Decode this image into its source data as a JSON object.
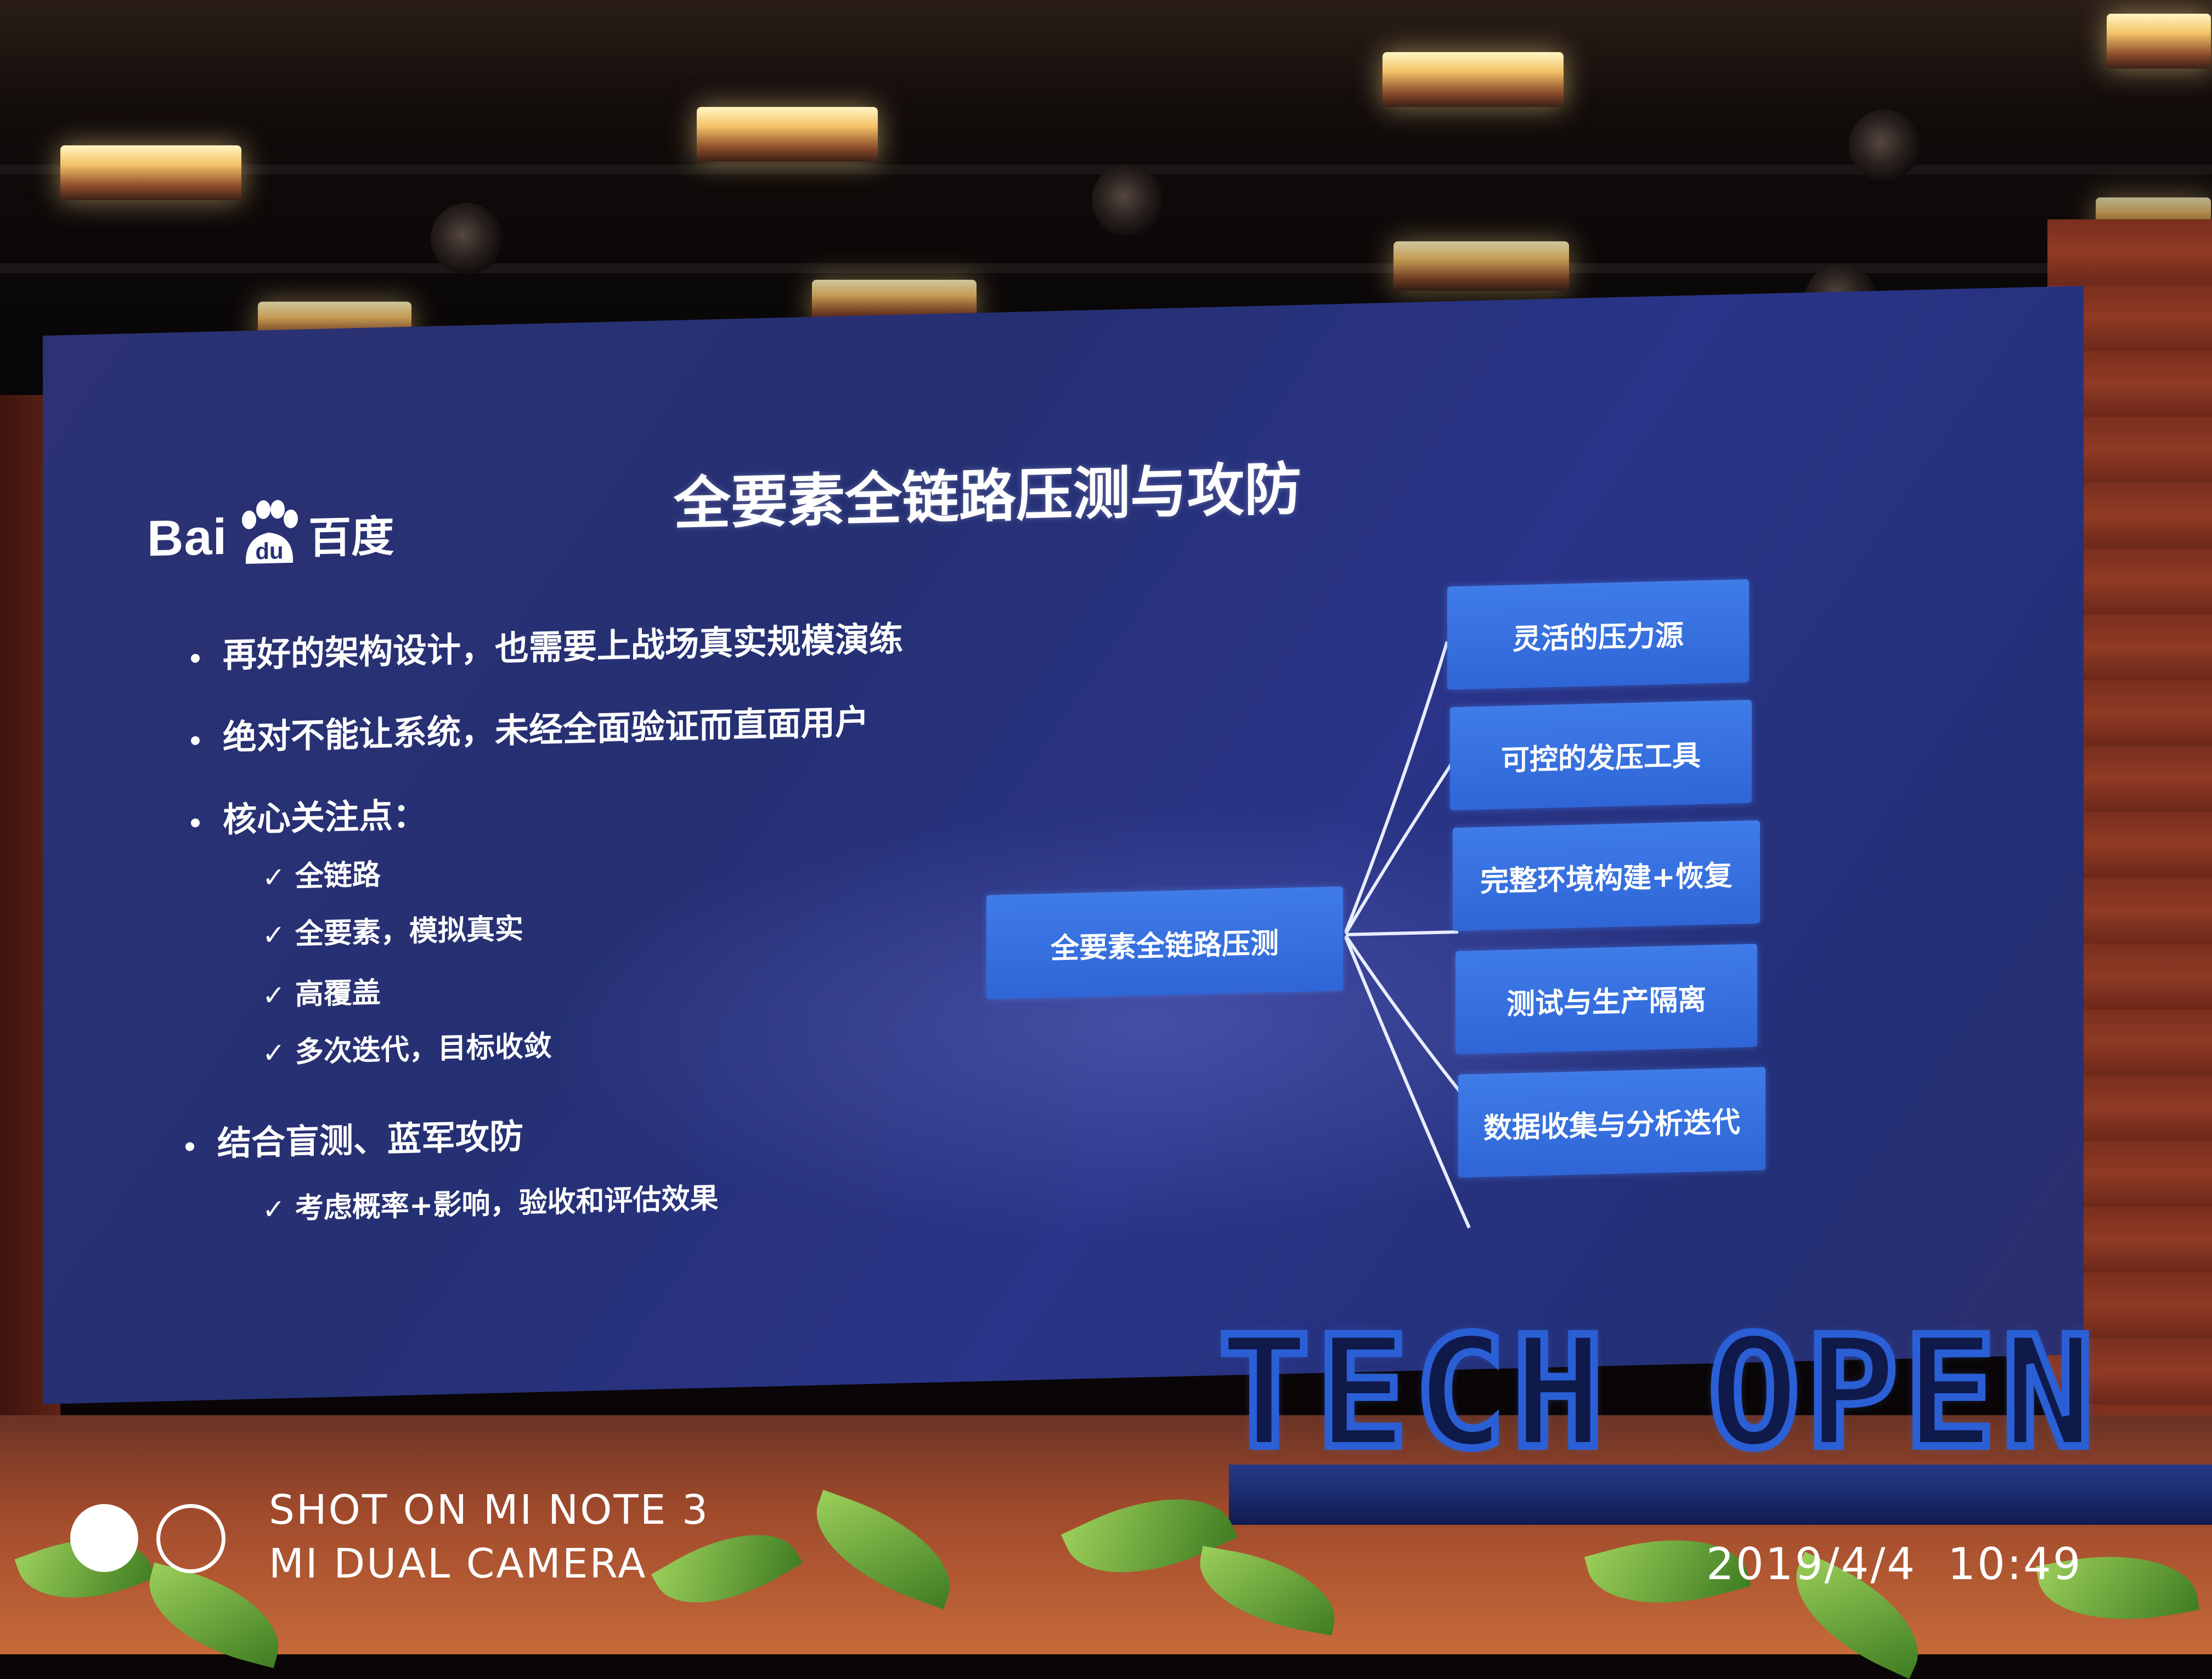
{
  "slide": {
    "logo": {
      "latin": "Bai",
      "paw_text": "du",
      "chinese": "百度"
    },
    "title": "全要素全链路压测与攻防",
    "bullets": [
      "再好的架构设计，也需要上战场真实规模演练",
      "绝对不能让系统，未经全面验证而直面用户",
      "核心关注点："
    ],
    "focus_checks": [
      "全链路",
      "全要素，模拟真实",
      "高覆盖",
      "多次迭代，目标收敛"
    ],
    "bullet_last": "结合盲测、蓝军攻防",
    "last_check": "考虑概率+影响，验收和评估效果",
    "check_mark": "✓",
    "diagram": {
      "center": "全要素全链路压测",
      "branches": [
        "灵活的压力源",
        "可控的发压工具",
        "完整环境构建+恢复",
        "测试与生产隔离",
        "数据收集与分析迭代"
      ]
    }
  },
  "stage_sign": "TECH OPEN",
  "watermark": {
    "line1": "SHOT ON MI NOTE 3",
    "line2": "MI DUAL CAMERA",
    "datetime": "2019/4/4  10:49"
  },
  "colors": {
    "screen": "#263177",
    "box_blue": "#3a74e3",
    "sign_blue": "#2a5fd6"
  }
}
